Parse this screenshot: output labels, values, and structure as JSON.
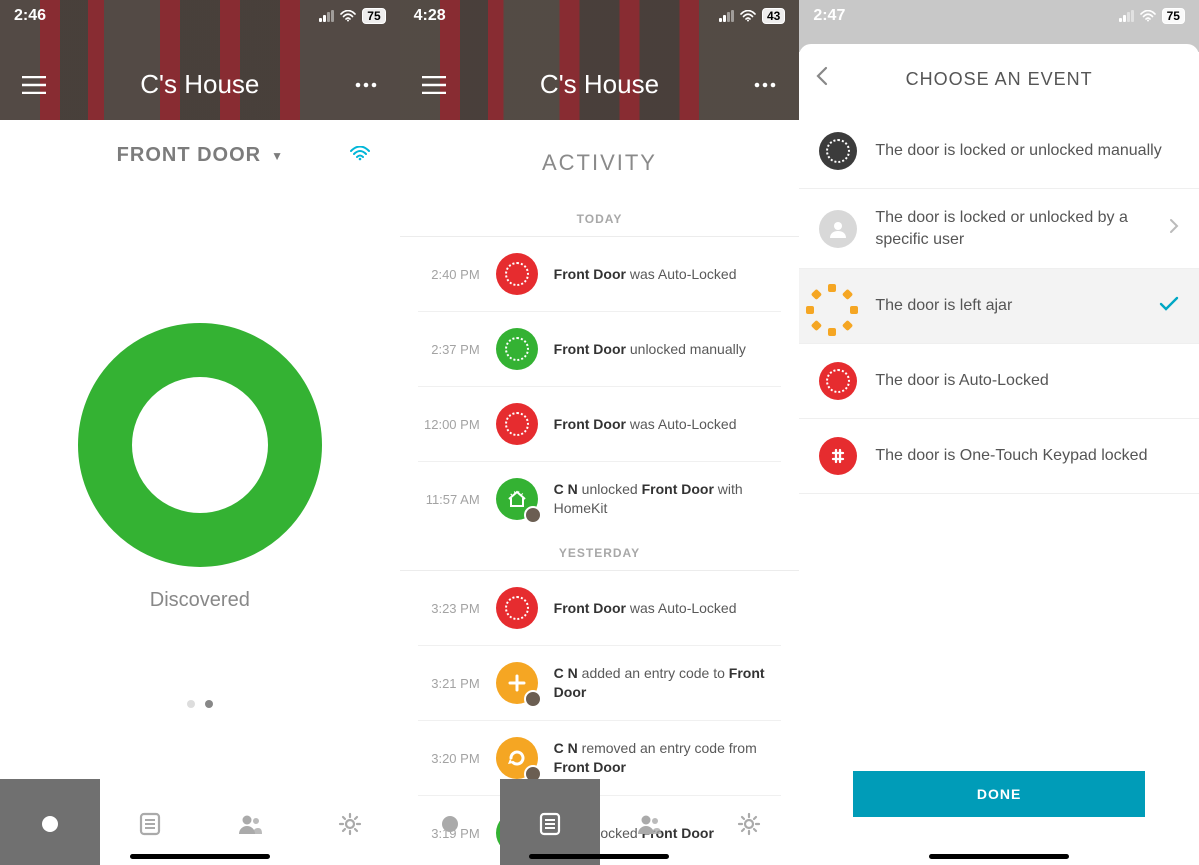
{
  "screen1": {
    "status": {
      "time": "2:46",
      "battery": "75"
    },
    "house_title": "C's House",
    "door_label": "FRONT DOOR",
    "ring_label": "Discovered"
  },
  "screen2": {
    "status": {
      "time": "4:28",
      "battery": "43"
    },
    "house_title": "C's House",
    "title": "ACTIVITY",
    "today_label": "TODAY",
    "yesterday_label": "YESTERDAY",
    "today": [
      {
        "time": "2:40 PM",
        "bold": "Front Door",
        "rest": " was Auto-Locked",
        "color": "red"
      },
      {
        "time": "2:37 PM",
        "bold": "Front Door",
        "rest": " unlocked manually",
        "color": "green"
      },
      {
        "time": "12:00 PM",
        "bold": "Front Door",
        "rest": " was Auto-Locked",
        "color": "red"
      },
      {
        "time": "11:57 AM",
        "prefix": "C N ",
        "mid": "unlocked ",
        "bold": "Front Door",
        "rest": " with HomeKit",
        "color": "green",
        "avatar": true,
        "house": true
      }
    ],
    "yesterday": [
      {
        "time": "3:23 PM",
        "bold": "Front Door",
        "rest": " was Auto-Locked",
        "color": "red"
      },
      {
        "time": "3:21 PM",
        "prefix": "C N ",
        "mid": "added an entry code to ",
        "bold": "Front Door",
        "color": "orange",
        "avatar": true,
        "glyph": "plus"
      },
      {
        "time": "3:20 PM",
        "prefix": "C N ",
        "mid": "removed an entry code from ",
        "bold": "Front Door",
        "color": "orange",
        "avatar": true,
        "glyph": "undo"
      },
      {
        "time": "3:19 PM",
        "prefix": "C N ",
        "mid": "unlocked ",
        "bold": "Front Door",
        "color": "green",
        "avatar": true,
        "glyph": "ring"
      }
    ]
  },
  "screen3": {
    "status": {
      "time": "2:47",
      "battery": "75"
    },
    "title": "CHOOSE AN EVENT",
    "options": [
      {
        "text": "The door is locked or unlocked manually",
        "icon": "dark-dots"
      },
      {
        "text": "The door is locked or unlocked by a specific user",
        "icon": "user",
        "chevron": true
      },
      {
        "text": "The door is left ajar",
        "icon": "ajar",
        "selected": true
      },
      {
        "text": "The door is Auto-Locked",
        "icon": "red-dots"
      },
      {
        "text": "The door is One-Touch Keypad locked",
        "icon": "red-hash"
      }
    ],
    "done_label": "DONE"
  }
}
